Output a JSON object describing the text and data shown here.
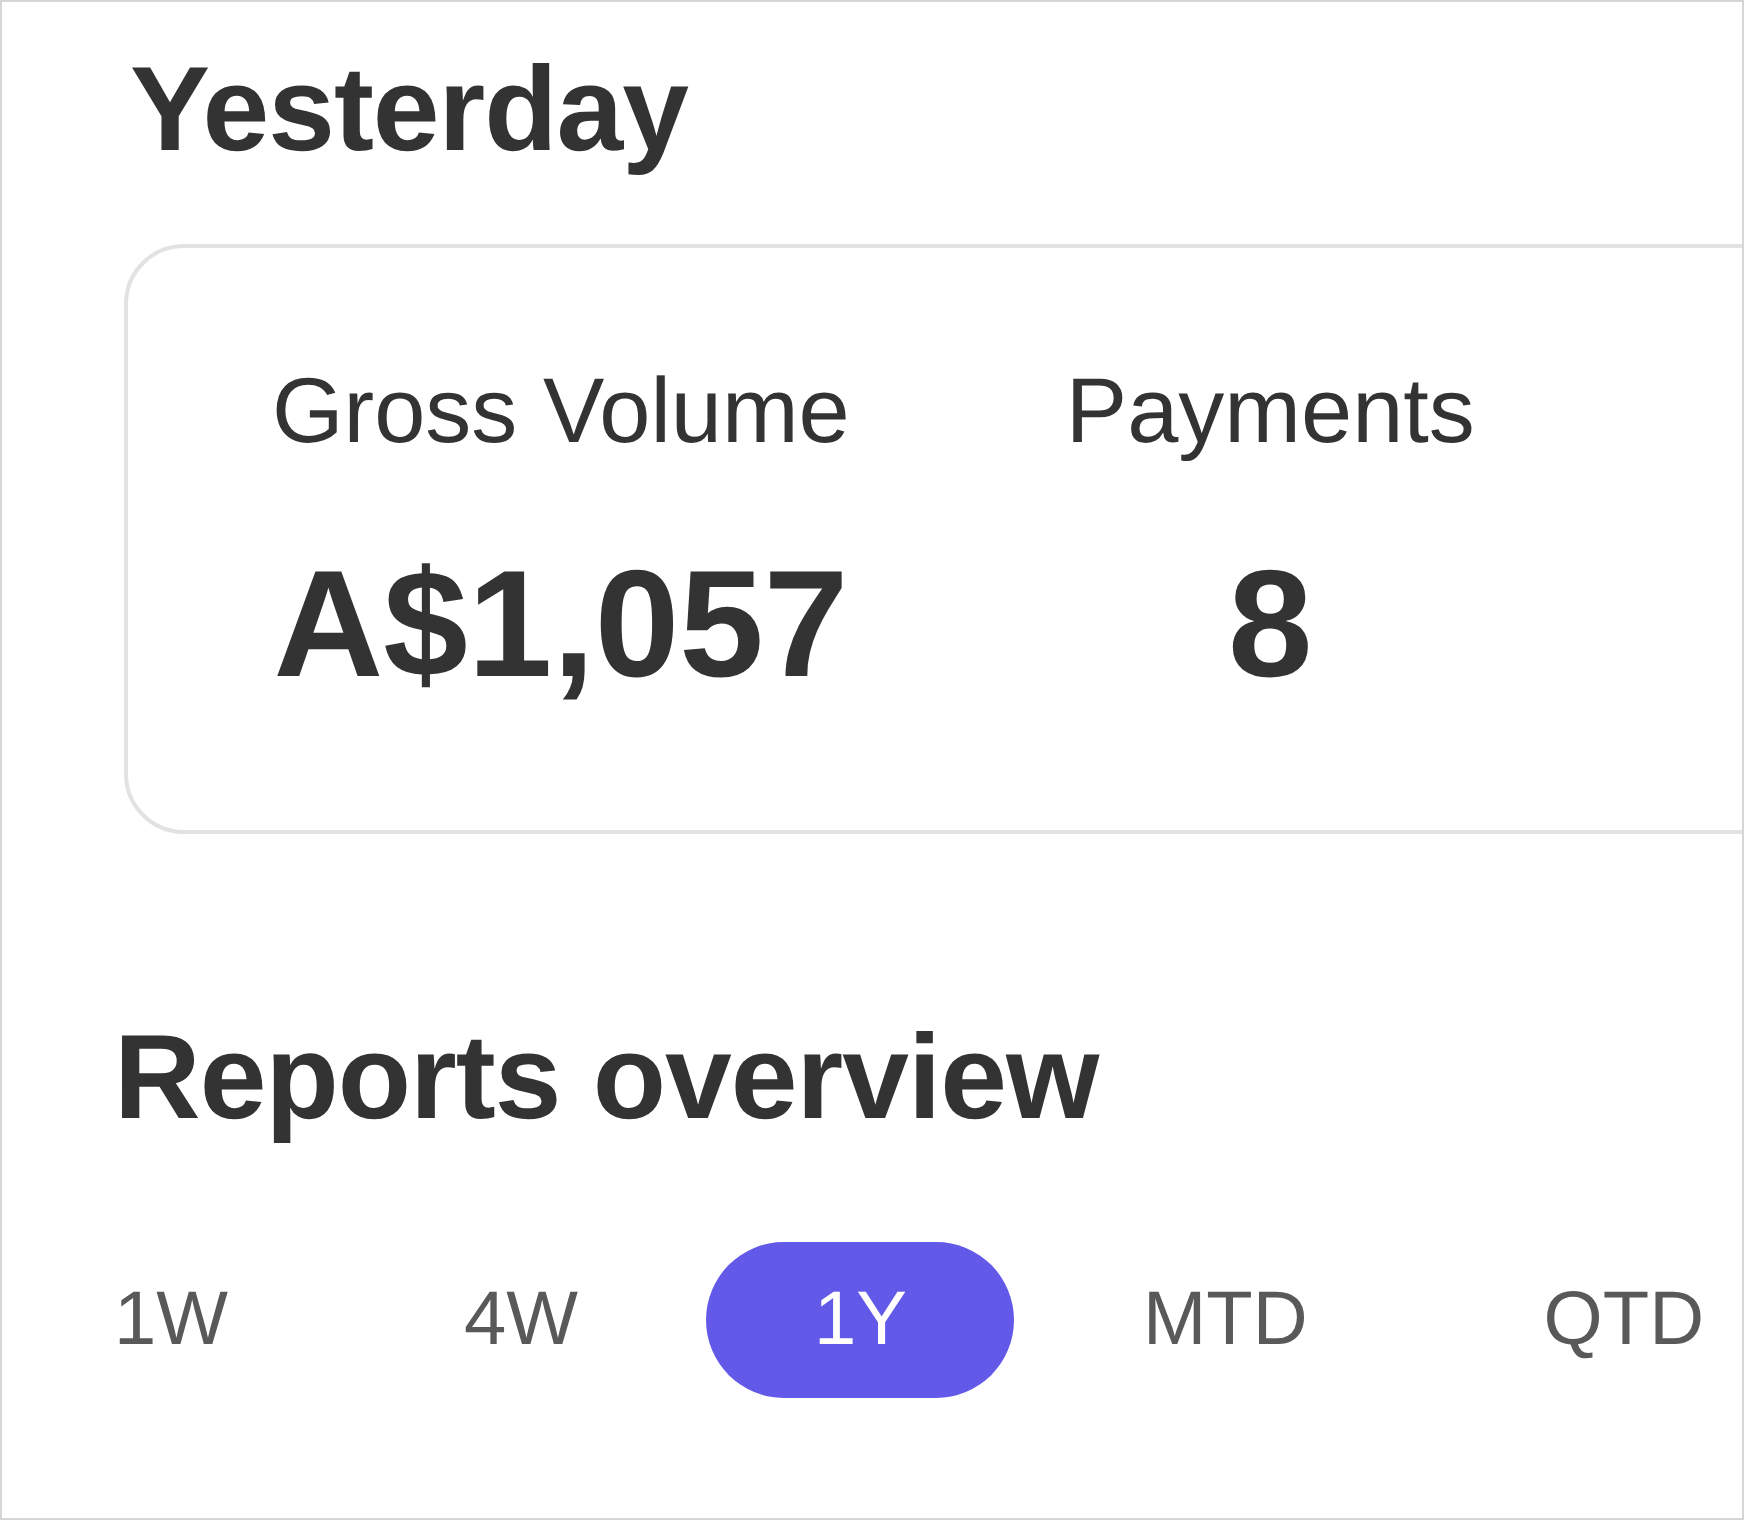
{
  "yesterday": {
    "title": "Yesterday",
    "metrics": [
      {
        "label": "Gross Volume",
        "value": "A$1,057"
      },
      {
        "label": "Payments",
        "value": "8"
      }
    ]
  },
  "reports_overview": {
    "title": "Reports overview",
    "tabs": [
      {
        "label": "1W",
        "selected": false
      },
      {
        "label": "4W",
        "selected": false
      },
      {
        "label": "1Y",
        "selected": true
      },
      {
        "label": "MTD",
        "selected": false
      },
      {
        "label": "QTD",
        "selected": false
      }
    ]
  }
}
